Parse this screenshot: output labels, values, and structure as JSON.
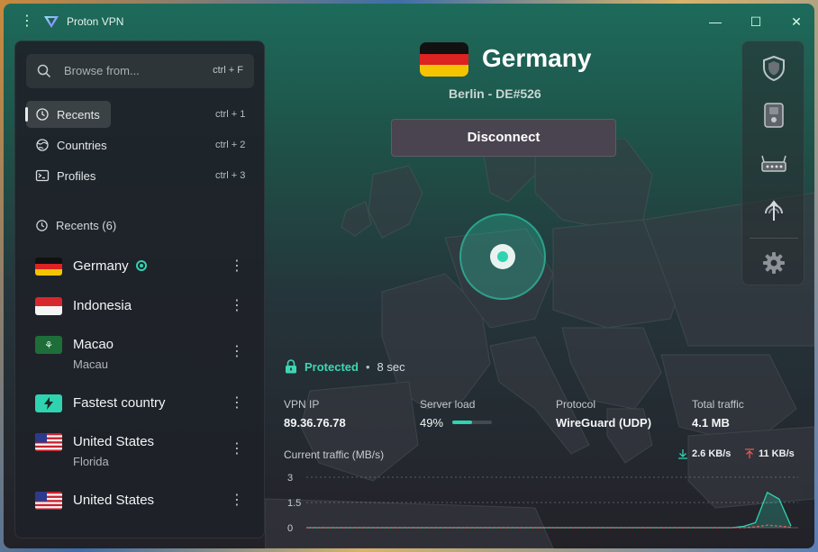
{
  "app": {
    "title": "Proton VPN"
  },
  "window_controls": {
    "minimize": "—",
    "maximize": "☐",
    "close": "✕",
    "menu": "⋮"
  },
  "sidebar": {
    "search": {
      "placeholder": "Browse from...",
      "shortcut": "ctrl + F"
    },
    "nav": [
      {
        "label": "Recents",
        "shortcut": "ctrl + 1",
        "icon": "history-icon",
        "active": true
      },
      {
        "label": "Countries",
        "shortcut": "ctrl + 2",
        "icon": "globe-icon",
        "active": false
      },
      {
        "label": "Profiles",
        "shortcut": "ctrl + 3",
        "icon": "terminal-icon",
        "active": false
      }
    ],
    "recents_header": "Recents (6)",
    "recents": [
      {
        "name": "Germany",
        "sub": "",
        "flag": "de",
        "connected": true
      },
      {
        "name": "Indonesia",
        "sub": "",
        "flag": "id",
        "connected": false
      },
      {
        "name": "Macao",
        "sub": "Macau",
        "flag": "mo",
        "connected": false
      },
      {
        "name": "Fastest country",
        "sub": "",
        "flag": "fastest",
        "connected": false
      },
      {
        "name": "United States",
        "sub": "Florida",
        "flag": "us",
        "connected": false
      },
      {
        "name": "United States",
        "sub": "",
        "flag": "us",
        "connected": false
      }
    ]
  },
  "connection": {
    "country": "Germany",
    "server": "Berlin - DE#526",
    "disconnect_label": "Disconnect",
    "status": "Protected",
    "separator": "•",
    "duration": "8 sec"
  },
  "stats": {
    "vpn_ip_label": "VPN IP",
    "vpn_ip": "89.36.76.78",
    "server_load_label": "Server load",
    "server_load": "49%",
    "server_load_fraction": 0.49,
    "protocol_label": "Protocol",
    "protocol": "WireGuard (UDP)",
    "total_traffic_label": "Total traffic",
    "total_traffic": "4.1 MB"
  },
  "traffic": {
    "header": "Current traffic (MB/s)",
    "download": "2.6 KB/s",
    "upload": "11 KB/s",
    "y_ticks": [
      "3",
      "1.5",
      "0"
    ],
    "ylim": [
      0,
      3
    ]
  },
  "chart_data": {
    "type": "area",
    "title": "Current traffic (MB/s)",
    "xlabel": "",
    "ylabel": "",
    "ylim": [
      0,
      3
    ],
    "y_ticks": [
      0,
      1.5,
      3
    ],
    "grid": true,
    "series": [
      {
        "values": [
          0,
          0,
          0,
          0,
          0,
          0,
          0,
          0,
          0,
          0,
          0,
          0,
          0,
          0,
          0,
          0,
          0,
          0,
          0,
          0,
          0,
          0,
          0,
          0,
          0,
          0,
          0,
          0,
          0,
          0,
          0,
          0,
          0,
          0,
          0,
          0,
          0,
          0.08,
          0.3,
          2.1,
          1.7,
          0.1
        ]
      },
      {
        "values": [
          0,
          0,
          0,
          0,
          0,
          0,
          0,
          0,
          0,
          0,
          0,
          0,
          0,
          0,
          0,
          0,
          0,
          0,
          0,
          0,
          0,
          0,
          0,
          0,
          0,
          0,
          0,
          0,
          0,
          0,
          0,
          0,
          0,
          0,
          0,
          0,
          0,
          0,
          0.05,
          0.15,
          0.1,
          0.02
        ]
      }
    ],
    "colors": [
      "#2fd3b0",
      "#e05a5a"
    ]
  },
  "rail": {
    "items": [
      {
        "icon": "shield-icon"
      },
      {
        "icon": "killswitch-icon"
      },
      {
        "icon": "router-icon"
      },
      {
        "icon": "port-forwarding-icon"
      },
      {
        "icon": "settings-icon"
      }
    ]
  },
  "colors": {
    "accent": "#2fd3b0",
    "upload": "#e05a5a",
    "button": "#4a4450"
  }
}
